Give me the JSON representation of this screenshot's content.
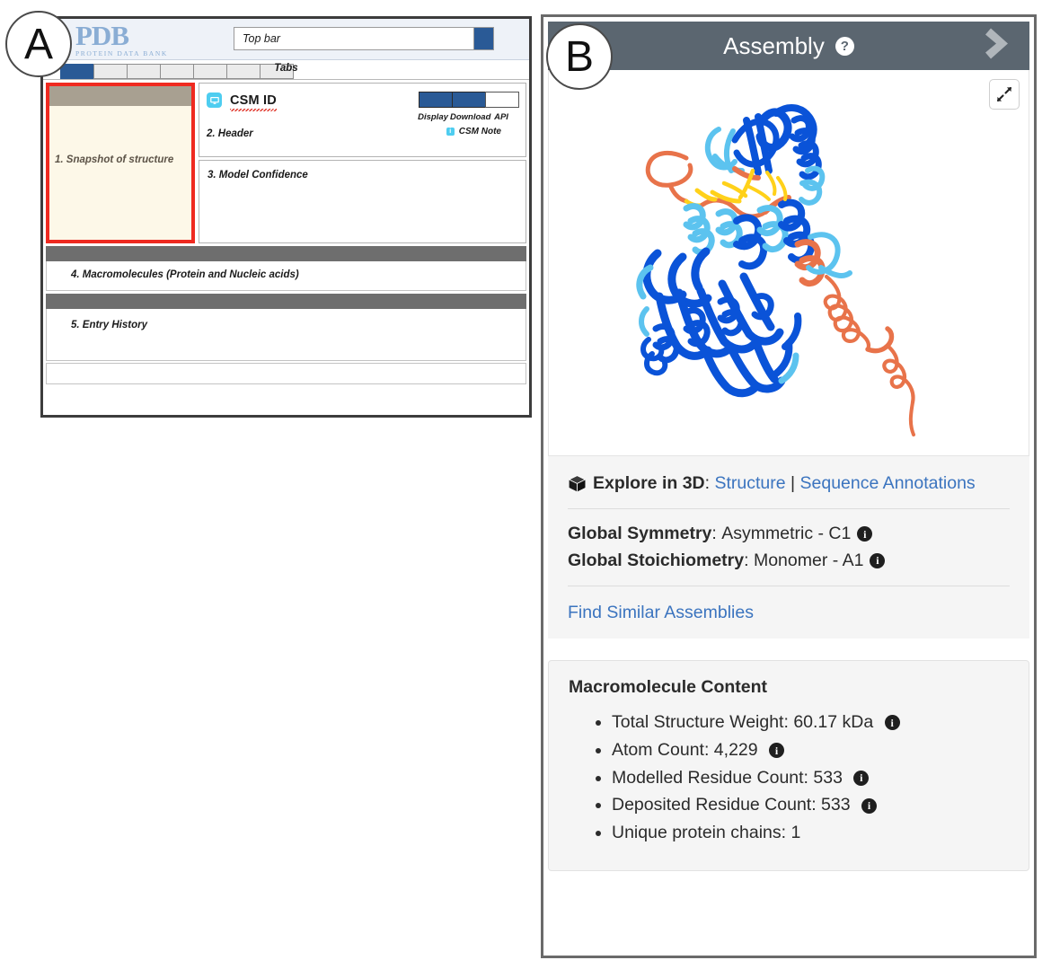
{
  "figure": {
    "panel_a_letter": "A",
    "panel_b_letter": "B"
  },
  "panel_a": {
    "logo": {
      "main": "PDB",
      "sub": "PROTEIN DATA BANK"
    },
    "search": {
      "placeholder": "Top bar",
      "value": "Top bar"
    },
    "tabs_label": "Tabs",
    "tabs": [
      {
        "label": "",
        "active": true
      },
      {
        "label": "",
        "active": false
      },
      {
        "label": "",
        "active": false
      },
      {
        "label": "",
        "active": false
      },
      {
        "label": "",
        "active": false
      },
      {
        "label": "",
        "active": false
      },
      {
        "label": "",
        "active": false
      }
    ],
    "snapshot_label": "1. Snapshot of structure",
    "header_card": {
      "csm_id": "CSM ID",
      "section_label": "2. Header",
      "buttons": [
        "Display",
        "Download",
        "API"
      ],
      "note_label": "CSM Note",
      "note_icon_letter": "i"
    },
    "model_confidence_label": "3. Model Confidence",
    "sections": [
      {
        "label": "4. Macromolecules (Protein and Nucleic acids)"
      },
      {
        "label": "5. Entry History"
      }
    ]
  },
  "panel_b": {
    "header": {
      "title": "Assembly",
      "help_glyph": "?",
      "chevron_icon": "chevron-right-icon"
    },
    "viewer": {
      "expand_icon": "expand-fullscreen-icon",
      "molecule_description": "AlphaFold pLDDT-colored protein ribbon model: compact blue high-confidence domain with an orange low-confidence extended tail"
    },
    "explore": {
      "cube_icon": "cube-3d-icon",
      "label": "Explore in 3D",
      "colon": ":",
      "links": [
        "Structure",
        "Sequence Annotations"
      ],
      "separator": "|"
    },
    "symmetry": {
      "global_symmetry_label": "Global Symmetry",
      "global_symmetry_value": "Asymmetric - C1",
      "global_stoichiometry_label": "Global Stoichiometry",
      "global_stoichiometry_value": "Monomer - A1",
      "info_glyph": "i"
    },
    "find_similar_label": "Find Similar Assemblies",
    "macromolecule": {
      "title": "Macromolecule Content",
      "items": [
        {
          "text": "Total Structure Weight: 60.17 kDa",
          "info": true
        },
        {
          "text": "Atom Count: 4,229",
          "info": true
        },
        {
          "text": "Modelled Residue Count: 533",
          "info": true
        },
        {
          "text": "Deposited Residue Count: 533",
          "info": true
        },
        {
          "text": "Unique protein chains: 1",
          "info": false
        }
      ]
    }
  },
  "colors": {
    "pdb_logo_blue": "#8aadd4",
    "button_blue": "#2a5a96",
    "header_slate": "#5b6670",
    "link_blue": "#3b74bf",
    "highlight_red": "#ef2a20",
    "snapshot_cream": "#fdf8e8",
    "snapshot_cap": "#a8a091",
    "section_bar_gray": "#6e6e6e",
    "csm_icon_cyan": "#4ecdf0",
    "plddt_very_high": "#0053d6",
    "plddt_confident": "#65cbf3",
    "plddt_low": "#ffdb13",
    "plddt_very_low": "#ff7d45"
  }
}
